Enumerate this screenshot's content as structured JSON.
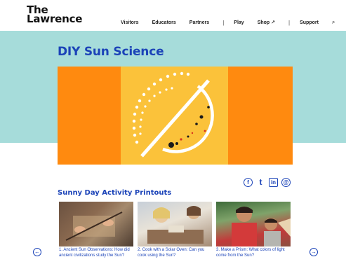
{
  "header": {
    "logo_line1": "The",
    "logo_line2": "Lawrence",
    "nav": {
      "visitors": "Visitors",
      "educators": "Educators",
      "partners": "Partners",
      "sep1": "|",
      "play": "Play",
      "shop": "Shop ↗",
      "sep2": "|",
      "support": "Support",
      "search_icon": "⌕"
    }
  },
  "page": {
    "title": "DIY Sun Science",
    "section_title": "Sunny Day Activity Printouts"
  },
  "social": {
    "facebook": "f",
    "twitter": "t",
    "linkedin": "in",
    "email": "@"
  },
  "cards": [
    {
      "caption": "1. Ancient Sun Observations: How did ancient civilizations study the Sun?"
    },
    {
      "caption": "2. Cook with a Solar Oven: Can you cook using the Sun?"
    },
    {
      "caption": "3. Make a Prism: What colors of light come from the Sun?"
    }
  ],
  "carousel": {
    "prev": "←",
    "next": "→"
  },
  "colors": {
    "brand_blue": "#1b43b8",
    "band_teal": "#a6dcda",
    "orange": "#ff8a0f",
    "yellow": "#fbc23a"
  }
}
